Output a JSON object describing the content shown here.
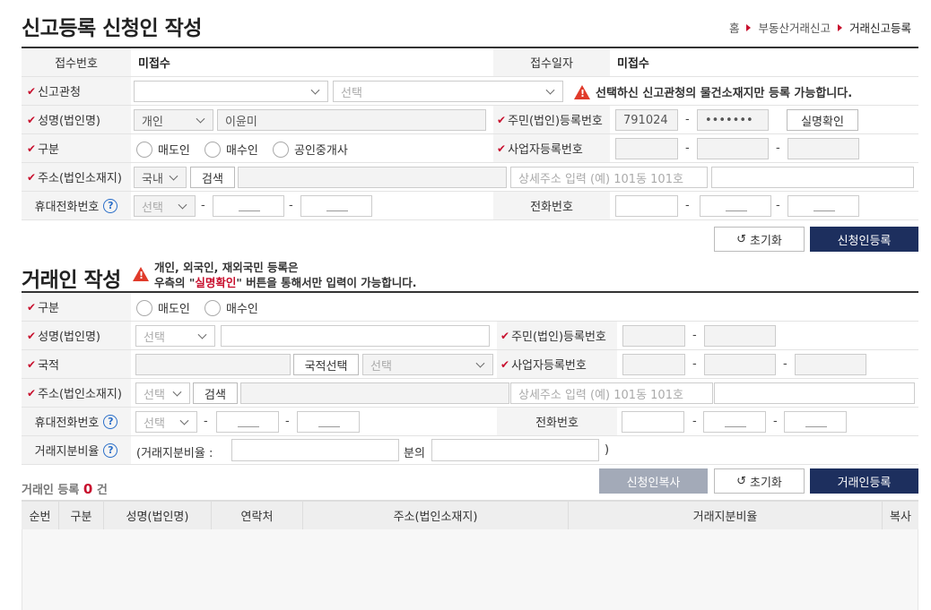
{
  "header": {
    "title": "신고등록 신청인 작성",
    "breadcrumb": [
      "홈",
      "부동산거래신고",
      "거래신고등록"
    ]
  },
  "applicant": {
    "receipt_no_label": "접수번호",
    "receipt_no_value": "미접수",
    "receipt_date_label": "접수일자",
    "receipt_date_value": "미접수",
    "office_label": "신고관청",
    "office_select2": "선택",
    "office_warning": "선택하신 신고관청의 물건소재지만 등록 가능합니다.",
    "name_label": "성명(법인명)",
    "name_type": "개인",
    "name_value": "이윤미",
    "rrn_label": "주민(법인)등록번호",
    "rrn_front": "791024",
    "rrn_back": "•••••••",
    "verify_button": "실명확인",
    "category_label": "구분",
    "category_options": [
      "매도인",
      "매수인",
      "공인중개사"
    ],
    "biz_label": "사업자등록번호",
    "address_label": "주소(법인소재지)",
    "address_country": "국내",
    "search_button": "검색",
    "address_detail_placeholder": "상세주소 입력 (예) 101동 101호",
    "mobile_label": "휴대전화번호",
    "mobile_select": "선택",
    "phone_label": "전화번호",
    "reset_button": "초기화",
    "register_button": "신청인등록"
  },
  "party": {
    "title": "거래인 작성",
    "notice_line1": "개인, 외국인, 재외국민 등록은",
    "notice_line2_pre": "우측의 \"",
    "notice_line2_em": "실명확인",
    "notice_line2_post": "\" 버튼을 통해서만 입력이 가능합니다.",
    "category_label": "구분",
    "category_options": [
      "매도인",
      "매수인"
    ],
    "name_label": "성명(법인명)",
    "name_select": "선택",
    "rrn_label": "주민(법인)등록번호",
    "nationality_label": "국적",
    "nationality_button": "국적선택",
    "nationality_select": "선택",
    "biz_label": "사업자등록번호",
    "address_label": "주소(법인소재지)",
    "address_select": "선택",
    "search_button": "검색",
    "address_detail_placeholder": "상세주소 입력 (예) 101동 101호",
    "mobile_label": "휴대전화번호",
    "mobile_select": "선택",
    "phone_label": "전화번호",
    "share_label": "거래지분비율",
    "share_prefix": "(거래지분비율 :",
    "share_mid": "분의",
    "share_suffix": ")",
    "copy_button": "신청인복사",
    "reset_button": "초기화",
    "register_button": "거래인등록"
  },
  "list": {
    "count_pre": "거래인 등록",
    "count": "0",
    "count_post": "건",
    "columns": [
      "순번",
      "구분",
      "성명(법인명)",
      "연락처",
      "주소(법인소재지)",
      "거래지분비율",
      "복사"
    ]
  },
  "colors": {
    "accent": "#c8102e",
    "navy": "#1d2f5e",
    "warning": "#e03a2a",
    "help": "#2a6ec8"
  }
}
